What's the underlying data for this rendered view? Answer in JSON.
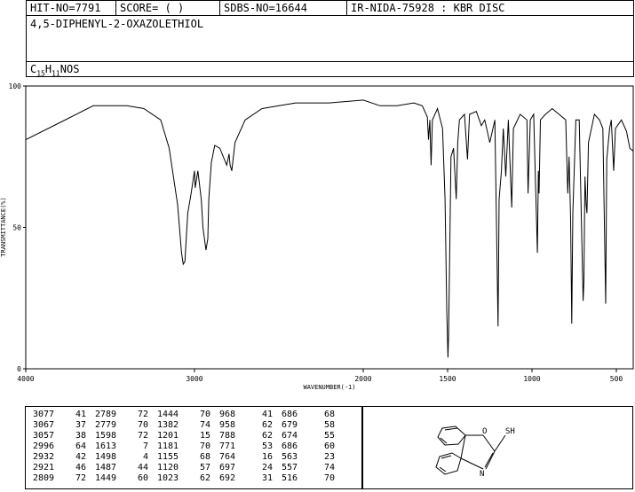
{
  "header": {
    "hit_no": "HIT-NO=7791",
    "score": "SCORE=  (  )",
    "sdbs_no": "SDBS-NO=16644",
    "ir_nida": "IR-NIDA-75928 : KBR DISC"
  },
  "compound": {
    "name": "4,5-DIPHENYL-2-OXAZOLETHIOL",
    "formula_c": "C",
    "formula_c_sub": "15",
    "formula_h": "H",
    "formula_h_sub": "11",
    "formula_rest": "NOS"
  },
  "chart_data": {
    "type": "line",
    "xlabel": "WAVENUMBER(-1)",
    "ylabel": "TRANSMITTANCE(%)",
    "xlim": [
      4000,
      400
    ],
    "ylim": [
      0,
      100
    ],
    "x_ticks": [
      4000,
      3000,
      2000,
      1500,
      1000,
      500
    ],
    "y_ticks": [
      0,
      50,
      100
    ],
    "grid": false,
    "spectrum": [
      [
        4000,
        81
      ],
      [
        3800,
        87
      ],
      [
        3600,
        93
      ],
      [
        3500,
        93
      ],
      [
        3400,
        93
      ],
      [
        3300,
        92
      ],
      [
        3200,
        88
      ],
      [
        3150,
        78
      ],
      [
        3100,
        58
      ],
      [
        3077,
        41
      ],
      [
        3067,
        37
      ],
      [
        3057,
        38
      ],
      [
        3040,
        55
      ],
      [
        3020,
        62
      ],
      [
        3000,
        70
      ],
      [
        2996,
        64
      ],
      [
        2980,
        70
      ],
      [
        2960,
        60
      ],
      [
        2950,
        50
      ],
      [
        2932,
        42
      ],
      [
        2921,
        46
      ],
      [
        2915,
        60
      ],
      [
        2900,
        73
      ],
      [
        2880,
        79
      ],
      [
        2850,
        78
      ],
      [
        2809,
        72
      ],
      [
        2795,
        76
      ],
      [
        2789,
        72
      ],
      [
        2779,
        70
      ],
      [
        2760,
        80
      ],
      [
        2700,
        88
      ],
      [
        2600,
        92
      ],
      [
        2500,
        93
      ],
      [
        2400,
        94
      ],
      [
        2200,
        94
      ],
      [
        2000,
        95
      ],
      [
        1900,
        93
      ],
      [
        1800,
        93
      ],
      [
        1700,
        94
      ],
      [
        1650,
        93
      ],
      [
        1620,
        89
      ],
      [
        1613,
        81
      ],
      [
        1605,
        88
      ],
      [
        1598,
        72
      ],
      [
        1590,
        88
      ],
      [
        1560,
        92
      ],
      [
        1530,
        85
      ],
      [
        1515,
        60
      ],
      [
        1505,
        20
      ],
      [
        1498,
        4
      ],
      [
        1494,
        12
      ],
      [
        1487,
        44
      ],
      [
        1480,
        75
      ],
      [
        1465,
        78
      ],
      [
        1449,
        60
      ],
      [
        1440,
        80
      ],
      [
        1444,
        70
      ],
      [
        1430,
        88
      ],
      [
        1400,
        90
      ],
      [
        1382,
        74
      ],
      [
        1370,
        90
      ],
      [
        1330,
        91
      ],
      [
        1300,
        86
      ],
      [
        1280,
        88
      ],
      [
        1250,
        80
      ],
      [
        1220,
        88
      ],
      [
        1201,
        15
      ],
      [
        1195,
        60
      ],
      [
        1181,
        70
      ],
      [
        1170,
        85
      ],
      [
        1155,
        68
      ],
      [
        1140,
        88
      ],
      [
        1120,
        57
      ],
      [
        1110,
        85
      ],
      [
        1070,
        90
      ],
      [
        1030,
        88
      ],
      [
        1023,
        62
      ],
      [
        1010,
        88
      ],
      [
        990,
        90
      ],
      [
        968,
        41
      ],
      [
        962,
        70
      ],
      [
        958,
        62
      ],
      [
        950,
        88
      ],
      [
        920,
        90
      ],
      [
        880,
        92
      ],
      [
        840,
        90
      ],
      [
        800,
        88
      ],
      [
        788,
        62
      ],
      [
        780,
        75
      ],
      [
        771,
        53
      ],
      [
        764,
        16
      ],
      [
        758,
        55
      ],
      [
        740,
        88
      ],
      [
        720,
        88
      ],
      [
        697,
        24
      ],
      [
        692,
        31
      ],
      [
        688,
        58
      ],
      [
        686,
        68
      ],
      [
        679,
        58
      ],
      [
        674,
        55
      ],
      [
        665,
        80
      ],
      [
        630,
        90
      ],
      [
        600,
        88
      ],
      [
        580,
        85
      ],
      [
        563,
        23
      ],
      [
        557,
        74
      ],
      [
        540,
        85
      ],
      [
        530,
        88
      ],
      [
        516,
        70
      ],
      [
        505,
        85
      ],
      [
        470,
        88
      ],
      [
        440,
        84
      ],
      [
        420,
        78
      ],
      [
        400,
        77
      ]
    ]
  },
  "peak_table": [
    [
      [
        "3077",
        "41"
      ],
      [
        "3067",
        "37"
      ],
      [
        "3057",
        "38"
      ],
      [
        "2996",
        "64"
      ],
      [
        "2932",
        "42"
      ],
      [
        "2921",
        "46"
      ],
      [
        "2809",
        "72"
      ]
    ],
    [
      [
        "2789",
        "72"
      ],
      [
        "2779",
        "70"
      ],
      [
        "1598",
        "72"
      ],
      [
        "1613",
        "7"
      ],
      [
        "1498",
        "4"
      ],
      [
        "1487",
        "44"
      ],
      [
        "1449",
        "60"
      ]
    ],
    [
      [
        "1444",
        "70"
      ],
      [
        "1382",
        "74"
      ],
      [
        "1201",
        "15"
      ],
      [
        "1181",
        "70"
      ],
      [
        "1155",
        "68"
      ],
      [
        "1120",
        "57"
      ],
      [
        "1023",
        "62"
      ]
    ],
    [
      [
        "968",
        "41"
      ],
      [
        "958",
        "62"
      ],
      [
        "788",
        "62"
      ],
      [
        "771",
        "53"
      ],
      [
        "764",
        "16"
      ],
      [
        "697",
        "24"
      ],
      [
        "692",
        "31"
      ]
    ],
    [
      [
        "686",
        "68"
      ],
      [
        "679",
        "58"
      ],
      [
        "674",
        "55"
      ],
      [
        "686",
        "60"
      ],
      [
        "563",
        "23"
      ],
      [
        "557",
        "74"
      ],
      [
        "516",
        "70"
      ]
    ]
  ],
  "structure": {
    "atom_o": "O",
    "atom_n": "N",
    "atom_sh": "SH"
  }
}
